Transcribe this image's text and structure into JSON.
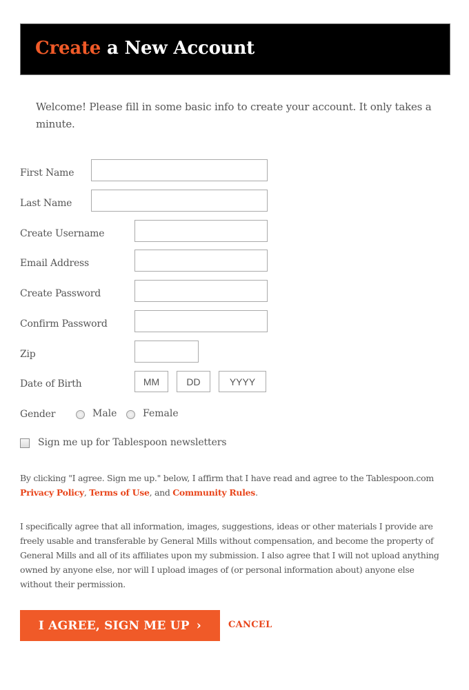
{
  "header": {
    "title_accent": "Create",
    "title_rest": " a New Account"
  },
  "welcome_text": "Welcome! Please fill in some basic info to create your account. It only takes a minute.",
  "form": {
    "first_name": {
      "label": "First Name",
      "value": ""
    },
    "last_name": {
      "label": "Last Name",
      "value": ""
    },
    "username": {
      "label": "Create Username",
      "value": ""
    },
    "email": {
      "label": "Email Address",
      "value": ""
    },
    "password": {
      "label": "Create Password",
      "value": ""
    },
    "confirm_password": {
      "label": "Confirm Password",
      "value": ""
    },
    "zip": {
      "label": "Zip",
      "value": ""
    },
    "dob": {
      "label": "Date of Birth",
      "month_placeholder": "MM",
      "day_placeholder": "DD",
      "year_placeholder": "YYYY"
    },
    "gender": {
      "label": "Gender",
      "options": [
        "Male",
        "Female"
      ],
      "selected": null
    },
    "newsletter": {
      "label": "Sign me up for Tablespoon newsletters",
      "checked": false
    }
  },
  "legal": {
    "agree_prefix": "By clicking \"I agree. Sign me up.\" below, I affirm that I have read and agree to the Tablespoon.com ",
    "privacy_policy": "Privacy Policy",
    "sep1": ", ",
    "terms_of_use": "Terms of Use",
    "sep2": ", and ",
    "community_rules": "Community Rules",
    "agree_suffix": ".",
    "specific_agreement": "I specifically agree that all information, images, suggestions, ideas or other materials I provide are freely usable and transferable by General Mills without compensation, and become the property of General Mills and all of its affiliates upon my submission. I also agree that I will not upload anything owned by anyone else, nor will I upload images of (or personal information about) anyone else without their permission."
  },
  "actions": {
    "submit_label": "I AGREE, SIGN ME UP",
    "submit_icon": "chevron-right-icon",
    "cancel_label": "CANCEL"
  },
  "colors": {
    "accent": "#f05a28",
    "link": "#e8461c",
    "header_bg": "#000000",
    "text": "#555555"
  }
}
